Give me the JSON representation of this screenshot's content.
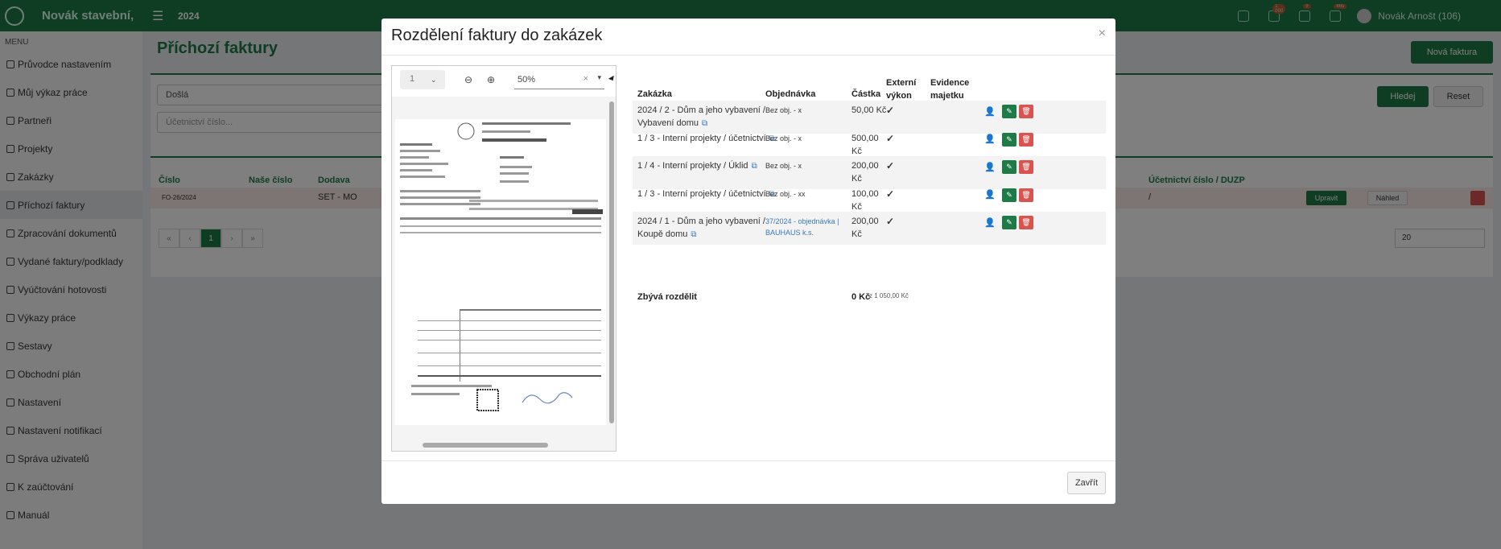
{
  "topbar": {
    "brand": "Novák stavební,",
    "year": "2024",
    "user": "Novák Arnošt (106)",
    "badges": [
      "1 000",
      "9",
      "465"
    ]
  },
  "sidebar": {
    "menu_label": "MENU",
    "items": [
      {
        "label": "Průvodce nastavením",
        "icon": "magic-icon"
      },
      {
        "label": "Můj výkaz práce",
        "icon": "clock-icon"
      },
      {
        "label": "Partneři",
        "icon": "book-icon"
      },
      {
        "label": "Projekty",
        "icon": "projects-icon"
      },
      {
        "label": "Zakázky",
        "icon": "orders-icon"
      },
      {
        "label": "Příchozí faktury",
        "icon": "invoice-icon"
      },
      {
        "label": "Zpracování dokumentů",
        "icon": "documents-icon"
      },
      {
        "label": "Vydané faktury/podklady",
        "icon": "invoice-out-icon"
      },
      {
        "label": "Vyúčtování hotovosti",
        "icon": "cash-icon"
      },
      {
        "label": "Výkazy práce",
        "icon": "work-icon"
      },
      {
        "label": "Sestavy",
        "icon": "reports-icon"
      },
      {
        "label": "Obchodní plán",
        "icon": "plan-icon"
      },
      {
        "label": "Nastavení",
        "icon": "settings-icon"
      },
      {
        "label": "Nastavení notifikací",
        "icon": "bell-icon"
      },
      {
        "label": "Správa uživatelů",
        "icon": "users-icon"
      },
      {
        "label": "K zaúčtování",
        "icon": "folder-icon"
      },
      {
        "label": "Manuál",
        "icon": "manual-icon"
      }
    ]
  },
  "page": {
    "title": "Příchozí faktury",
    "new_button": "Nová faktura",
    "filter_select": "Došlá",
    "filter_placeholder": "Účetnictví číslo...",
    "search_button": "Hledej",
    "reset_button": "Reset",
    "columns": [
      "Číslo",
      "Naše číslo",
      "Dodava",
      "Účetnictví číslo / DUZP"
    ],
    "row": {
      "number": "FO-26/2024",
      "supplier": "SET - MO",
      "accounting": "/",
      "edit": "Upravit",
      "preview": "Náhled"
    },
    "per_page": "20",
    "pager": [
      "«",
      "‹",
      "1",
      "›",
      "»"
    ]
  },
  "modal": {
    "title": "Rozdělení faktury do zakázek",
    "close_x": "×",
    "viewer": {
      "page": "1",
      "zoom": "50%"
    },
    "headers": {
      "order": "Zakázka",
      "purchase": "Objednávka",
      "amount": "Částka",
      "external": "Externí výkon",
      "asset": "Evidence majetku"
    },
    "rows": [
      {
        "order": "2024 / 2 - Dům a jeho vybavení / Vybavení domu",
        "purchase": "Bez obj. - x",
        "purchase_link": false,
        "amount": "50,00 Kč",
        "external": "✓"
      },
      {
        "order": "1 / 3 - Interní projekty / účetnictví",
        "purchase": "Bez obj. - x",
        "purchase_link": false,
        "amount": "500,00 Kč",
        "external": "✓"
      },
      {
        "order": "1 / 4 - Interní projekty / Úklid",
        "purchase": "Bez obj. - x",
        "purchase_link": false,
        "amount": "200,00 Kč",
        "external": "✓"
      },
      {
        "order": "1 / 3 - Interní projekty / účetnictví",
        "purchase": "Bez obj. - xx",
        "purchase_link": false,
        "amount": "100,00 Kč",
        "external": "✓"
      },
      {
        "order": "2024 / 1 - Dům a jeho vybavení / Koupě domu",
        "purchase": "37/2024 - objednávka | BAUHAUS k.s.",
        "purchase_link": true,
        "amount": "200,00 Kč",
        "external": "✓"
      }
    ],
    "remaining_label": "Zbývá rozdělit",
    "remaining_value": "0 Kč",
    "remaining_of": "z 1 050,00 Kč",
    "close_button": "Zavřít"
  }
}
